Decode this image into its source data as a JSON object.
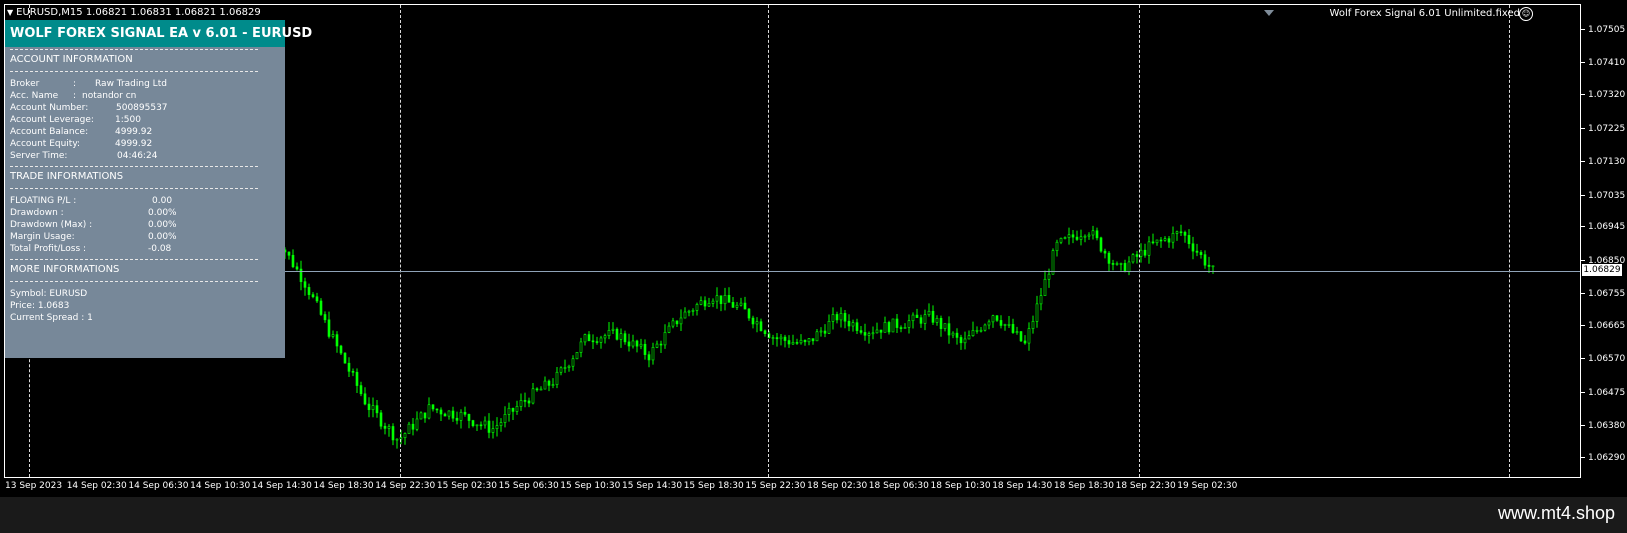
{
  "header": {
    "symbol_info": "EURUSD,M15  1.06821 1.06831 1.06821 1.06829",
    "ea_name": "Wolf Forex Signal 6.01 Unlimited.fixed",
    "smiley": "☺"
  },
  "panel": {
    "title": "WOLF FOREX SIGNAL EA v 6.01 - EURUSD",
    "account_section": "ACCOUNT INFORMATION",
    "account_rows": [
      {
        "label": "Broker",
        "sep": ":",
        "value": "Raw Trading Ltd"
      },
      {
        "label": "Acc. Name",
        "sep": ":",
        "value": "notandor cn"
      },
      {
        "label": "Account Number:",
        "value": "500895537"
      },
      {
        "label": "Account Leverage:",
        "value": "1:500"
      },
      {
        "label": "Account Balance:",
        "value": "4999.92"
      },
      {
        "label": "Account Equity:",
        "value": "4999.92"
      },
      {
        "label": "Server Time:",
        "value": "04:46:24"
      }
    ],
    "trade_section": "TRADE INFORMATIONS",
    "trade_rows": [
      {
        "label": "FLOATING P/L :",
        "value": "0.00"
      },
      {
        "label": "Drawdown :",
        "value": "0.00%"
      },
      {
        "label": "Drawdown (Max) :",
        "value": "0.00%"
      },
      {
        "label": "Margin Usage:",
        "value": "0.00%"
      },
      {
        "label": "Total Profit/Loss :",
        "value": "-0.08"
      }
    ],
    "more_section": "MORE INFORMATIONS",
    "more_rows": [
      {
        "text": "Symbol: EURUSD"
      },
      {
        "text": "Price:  1.0683"
      },
      {
        "text": "Current Spread  :  1"
      }
    ]
  },
  "axis": {
    "price_labels": [
      "1.07505",
      "1.07410",
      "1.07320",
      "1.07225",
      "1.07130",
      "1.07035",
      "1.06945",
      "1.06850",
      "1.06755",
      "1.06665",
      "1.06570",
      "1.06475",
      "1.06380",
      "1.06290"
    ],
    "current_price": "1.06829",
    "time_labels": [
      "13 Sep 2023",
      "14 Sep 02:30",
      "14 Sep 06:30",
      "14 Sep 10:30",
      "14 Sep 14:30",
      "14 Sep 18:30",
      "14 Sep 22:30",
      "15 Sep 02:30",
      "15 Sep 06:30",
      "15 Sep 10:30",
      "15 Sep 14:30",
      "15 Sep 18:30",
      "15 Sep 22:30",
      "18 Sep 02:30",
      "18 Sep 06:30",
      "18 Sep 10:30",
      "18 Sep 14:30",
      "18 Sep 18:30",
      "18 Sep 22:30",
      "19 Sep 02:30"
    ]
  },
  "colors": {
    "candle": "#00ff00",
    "background": "#000000",
    "panel_bg": "#778899",
    "panel_title_bg": "#008b8b"
  },
  "footer": {
    "watermark": "www.mt4.shop"
  },
  "chart_data": {
    "type": "candlestick",
    "symbol": "EURUSD",
    "timeframe": "M15",
    "ylim": [
      1.0629,
      1.07505
    ],
    "last_price": 1.06829,
    "close_path": [
      {
        "x": "14 Sep 13:30",
        "y": 1.0694
      },
      {
        "x": "14 Sep 14:30",
        "y": 1.068
      },
      {
        "x": "14 Sep 16:30",
        "y": 1.0662
      },
      {
        "x": "14 Sep 18:30",
        "y": 1.0645
      },
      {
        "x": "14 Sep 20:00",
        "y": 1.0635
      },
      {
        "x": "14 Sep 22:30",
        "y": 1.0644
      },
      {
        "x": "15 Sep 00:30",
        "y": 1.0642
      },
      {
        "x": "15 Sep 02:30",
        "y": 1.0638
      },
      {
        "x": "15 Sep 04:30",
        "y": 1.0646
      },
      {
        "x": "15 Sep 06:30",
        "y": 1.0652
      },
      {
        "x": "15 Sep 08:00",
        "y": 1.0664
      },
      {
        "x": "15 Sep 10:30",
        "y": 1.0665
      },
      {
        "x": "15 Sep 12:30",
        "y": 1.0659
      },
      {
        "x": "15 Sep 14:00",
        "y": 1.067
      },
      {
        "x": "15 Sep 15:30",
        "y": 1.0676
      },
      {
        "x": "15 Sep 18:30",
        "y": 1.0672
      },
      {
        "x": "15 Sep 21:00",
        "y": 1.0664
      },
      {
        "x": "15 Sep 23:30",
        "y": 1.0662
      },
      {
        "x": "18 Sep 01:30",
        "y": 1.067
      },
      {
        "x": "18 Sep 04:00",
        "y": 1.0666
      },
      {
        "x": "18 Sep 06:30",
        "y": 1.0668
      },
      {
        "x": "18 Sep 09:00",
        "y": 1.067
      },
      {
        "x": "18 Sep 11:00",
        "y": 1.0662
      },
      {
        "x": "18 Sep 13:00",
        "y": 1.0671
      },
      {
        "x": "18 Sep 16:00",
        "y": 1.0662
      },
      {
        "x": "18 Sep 17:30",
        "y": 1.069
      },
      {
        "x": "18 Sep 19:00",
        "y": 1.0695
      },
      {
        "x": "18 Sep 21:00",
        "y": 1.0683
      },
      {
        "x": "18 Sep 23:30",
        "y": 1.069
      },
      {
        "x": "19 Sep 02:30",
        "y": 1.0694
      },
      {
        "x": "19 Sep 04:30",
        "y": 1.06829
      }
    ]
  }
}
